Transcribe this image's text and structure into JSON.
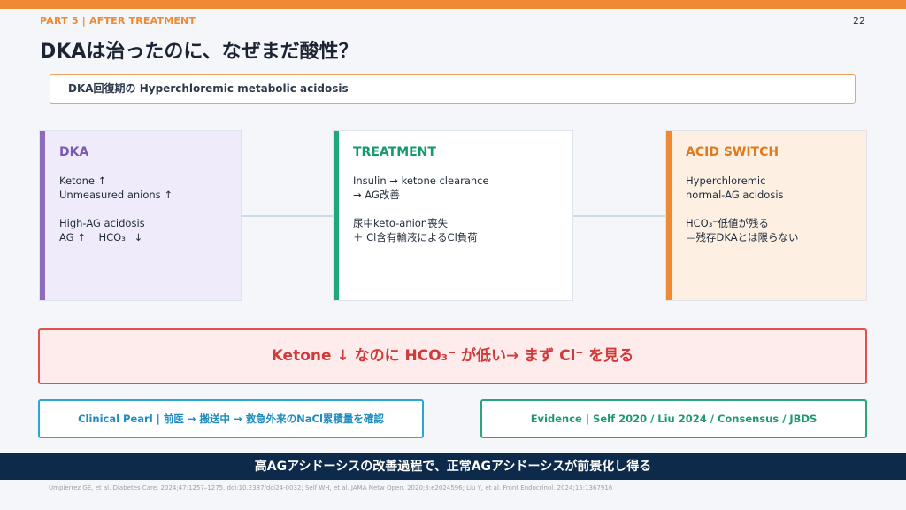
{
  "header": {
    "part": "PART 5 | AFTER TREATMENT",
    "page_number": "22",
    "title": "DKAは治ったのに、なぜまだ酸性？",
    "subtitle": "DKA回復期の Hyperchloremic metabolic acidosis"
  },
  "cards": [
    {
      "heading": "DKA",
      "lines": [
        "Ketone ↑",
        "Unmeasured anions ↑",
        "",
        "High-AG acidosis",
        "AG ↑    HCO₃⁻ ↓"
      ]
    },
    {
      "heading": "TREATMENT",
      "lines": [
        "Insulin → ketone clearance",
        "→ AG改善",
        "",
        "尿中keto-anion喪失",
        "＋ Cl含有輸液によるCl負荷"
      ]
    },
    {
      "heading": "ACID SWITCH",
      "lines": [
        "Hyperchloremic",
        "normal-AG acidosis",
        "",
        "HCO₃⁻低値が残る",
        "＝残存DKAとは限らない"
      ]
    }
  ],
  "key_message": "Ketone ↓ なのに HCO₃⁻ が低い→ まず Cl⁻ を見る",
  "clinical_pearl": "Clinical Pearl | 前医 → 搬送中 → 救急外来のNaCl累積量を確認",
  "evidence": "Evidence | Self 2020 / Liu 2024 / Consensus / JBDS",
  "banner": "高AGアシドーシスの改善過程で、正常AGアシドーシスが前景化し得る",
  "references": "Umpierrez GE, et al. Diabetes Care. 2024;47:1257–1275. doi:10.2337/dci24-0032; Self WH, et al. JAMA Netw Open. 2020;3:e2024596; Liu Y, et al. Front Endocrinol. 2024;15:1367916",
  "colors": {
    "accent_orange": "#ef8a33",
    "dka_purple": "#8f6bbd",
    "treatment_green": "#20a77a",
    "alert_red": "#e05252",
    "pearl_blue": "#2aa6d6",
    "banner_navy": "#0e2a4a"
  }
}
